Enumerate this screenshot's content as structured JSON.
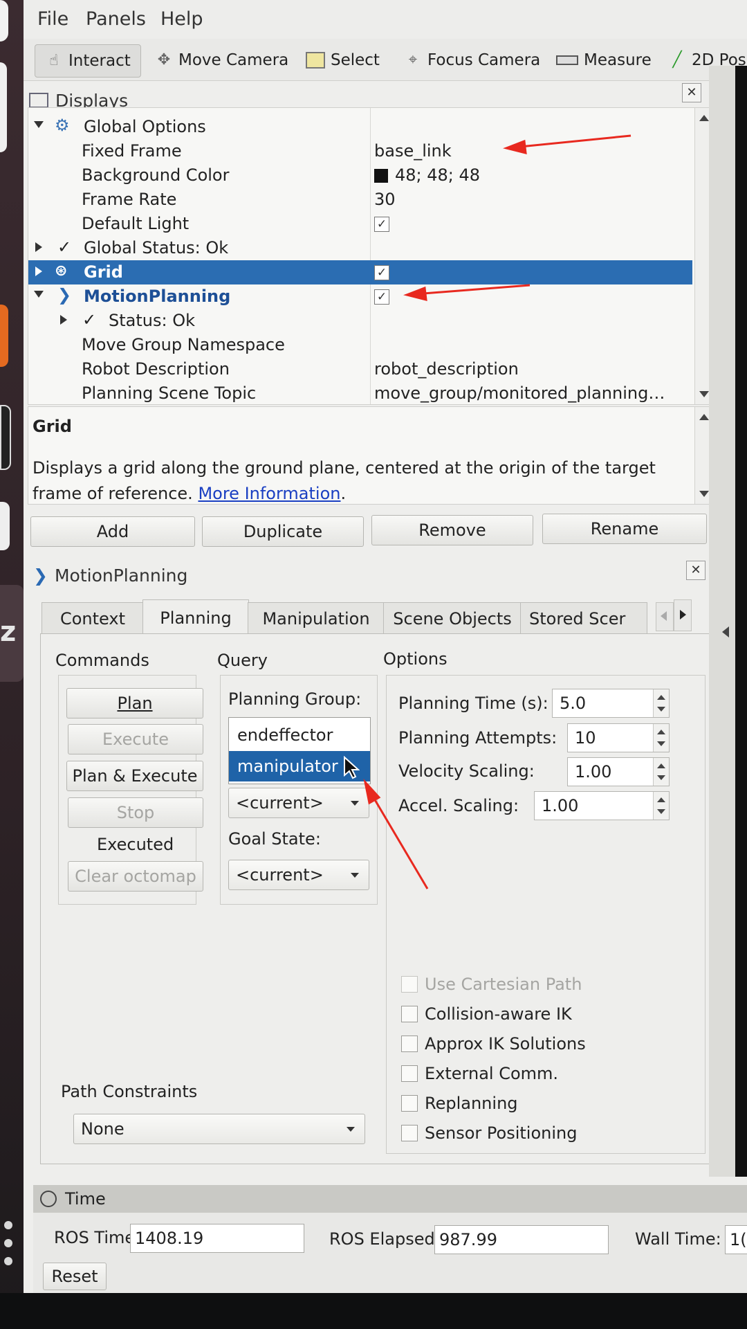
{
  "menubar": {
    "file": "File",
    "panels": "Panels",
    "help": "Help"
  },
  "toolbar": {
    "interact": "Interact",
    "move_camera": "Move Camera",
    "select": "Select",
    "focus_camera": "Focus Camera",
    "measure": "Measure",
    "pose_2d": "2D Pos"
  },
  "displays": {
    "title": "Displays",
    "rows": [
      {
        "name": "Global Options",
        "value": ""
      },
      {
        "name": "Fixed Frame",
        "value": "base_link"
      },
      {
        "name": "Background Color",
        "value": "48; 48; 48"
      },
      {
        "name": "Frame Rate",
        "value": "30"
      },
      {
        "name": "Default Light",
        "value": ""
      },
      {
        "name": "Global Status: Ok",
        "value": ""
      },
      {
        "name": "Grid",
        "value": ""
      },
      {
        "name": "MotionPlanning",
        "value": ""
      },
      {
        "name": "Status: Ok",
        "value": ""
      },
      {
        "name": "Move Group Namespace",
        "value": ""
      },
      {
        "name": "Robot Description",
        "value": "robot_description"
      },
      {
        "name": "Planning Scene Topic",
        "value": "move_group/monitored_planning…"
      }
    ],
    "check_mark": "✓"
  },
  "description": {
    "title": "Grid",
    "text": "Displays a grid along the ground plane, centered at the origin of the target frame of reference.",
    "link": "More Information",
    "period": "."
  },
  "display_buttons": {
    "add": "Add",
    "duplicate": "Duplicate",
    "remove": "Remove",
    "rename": "Rename"
  },
  "motion_planning": {
    "title": "MotionPlanning",
    "tabs": [
      "Context",
      "Planning",
      "Manipulation",
      "Scene Objects",
      "Stored Scer"
    ],
    "active_tab": "Planning",
    "commands": {
      "title": "Commands",
      "plan": "Plan",
      "execute": "Execute",
      "plan_execute": "Plan & Execute",
      "stop": "Stop",
      "executed": "Executed",
      "clear_octomap": "Clear octomap"
    },
    "query": {
      "title": "Query",
      "planning_group_label": "Planning Group:",
      "groups": [
        "endeffector",
        "manipulator"
      ],
      "selected_group": "manipulator",
      "start_state": "<current>",
      "goal_state_label": "Goal State:",
      "goal_state": "<current>"
    },
    "options": {
      "title": "Options",
      "planning_time_label": "Planning Time (s):",
      "planning_time": "5.0",
      "planning_attempts_label": "Planning Attempts:",
      "planning_attempts": "10",
      "velocity_scaling_label": "Velocity Scaling:",
      "velocity_scaling": "1.00",
      "accel_scaling_label": "Accel. Scaling:",
      "accel_scaling": "1.00",
      "checkboxes": [
        "Use Cartesian Path",
        "Collision-aware IK",
        "Approx IK Solutions",
        "External Comm.",
        "Replanning",
        "Sensor Positioning"
      ]
    },
    "path_constraints": {
      "label": "Path Constraints",
      "value": "None"
    }
  },
  "time": {
    "title": "Time",
    "ros_time_label": "ROS Time:",
    "ros_time": "1408.19",
    "ros_elapsed_label": "ROS Elapsed:",
    "ros_elapsed": "987.99",
    "wall_time_label": "Wall Time:",
    "wall_time": "1(",
    "reset": "Reset"
  },
  "colors": {
    "selection": "#2b6db2",
    "annotation_arrow": "#e8291f",
    "link": "#1a3fc2"
  },
  "icons": [
    "hand-icon",
    "move-camera-icon",
    "select-icon",
    "focus-camera-icon",
    "measure-icon",
    "pose-arrow-icon",
    "monitor-icon",
    "gear-icon",
    "grid-icon",
    "motion-planning-icon",
    "clock-icon",
    "close-icon"
  ]
}
